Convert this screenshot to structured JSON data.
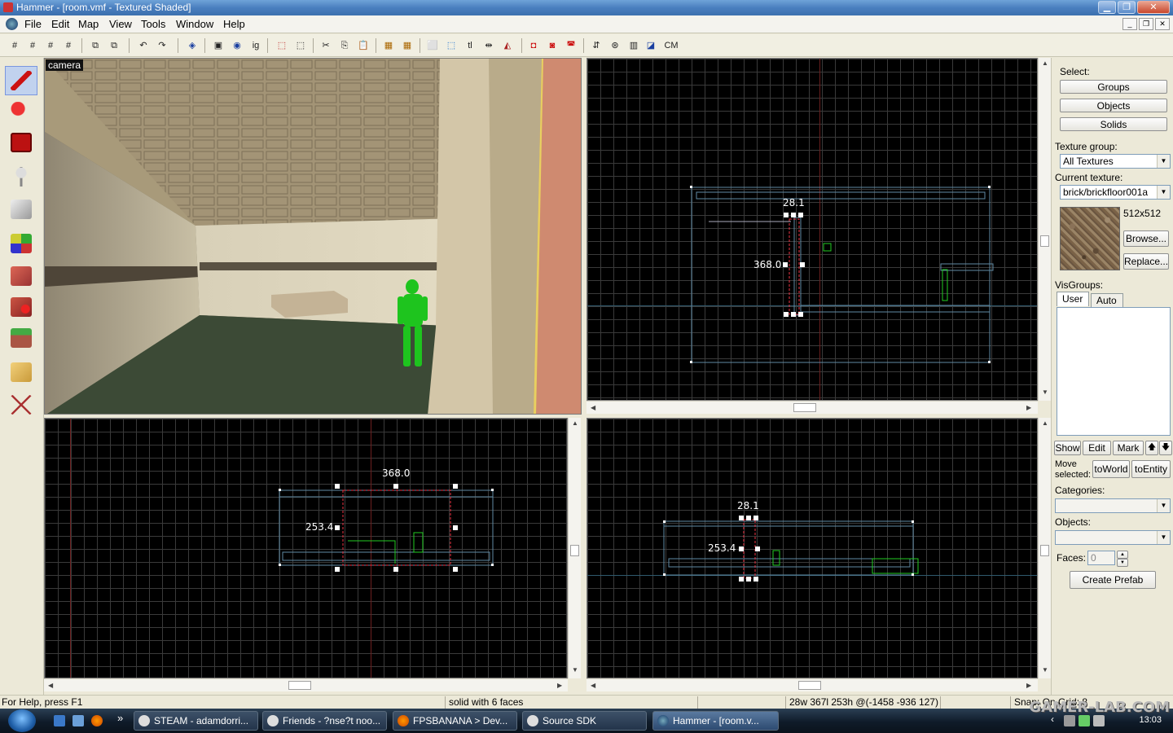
{
  "window": {
    "title": "Hammer - [room.vmf - Textured Shaded]"
  },
  "menu": {
    "items": [
      "File",
      "Edit",
      "Map",
      "View",
      "Tools",
      "Window",
      "Help"
    ]
  },
  "toolbar": {
    "tl_label": "tl",
    "cm_label": "CM"
  },
  "viewports": {
    "camera_label": "camera",
    "top": {
      "width_label": "28.1",
      "height_label": "368.0"
    },
    "front": {
      "width_label": "368.0",
      "height_label": "253.4"
    },
    "side": {
      "width_label": "28.1",
      "height_label": "253.4"
    }
  },
  "panel": {
    "select_label": "Select:",
    "groups_button": "Groups",
    "objects_button": "Objects",
    "solids_button": "Solids",
    "texture_group_label": "Texture group:",
    "texture_group_value": "All Textures",
    "current_texture_label": "Current texture:",
    "current_texture_value": "brick/brickfloor001a",
    "texture_size": "512x512",
    "browse_button": "Browse...",
    "replace_button": "Replace...",
    "visgroups_label": "VisGroups:",
    "tab_user": "User",
    "tab_auto": "Auto",
    "show_button": "Show",
    "edit_button": "Edit",
    "mark_button": "Mark",
    "up_arrow": "🡅",
    "down_arrow": "🡇",
    "move_selected_label_1": "Move",
    "move_selected_label_2": "selected:",
    "to_world_button": "toWorld",
    "to_entity_button": "toEntity",
    "categories_label": "Categories:",
    "objects_label": "Objects:",
    "faces_label": "Faces:",
    "faces_value": "0",
    "create_prefab_button": "Create Prefab"
  },
  "status": {
    "help": "For Help, press F1",
    "selection": "solid with 6 faces",
    "size": "28w 367l 253h @(-1458 -936 127)",
    "snap": "Snap: On Grid: 8"
  },
  "taskbar": {
    "tasks": [
      "STEAM - adamdorri...",
      "Friends - ?nse?t noo...",
      "FPSBANANA > Dev...",
      "Source SDK",
      "Hammer - [room.v..."
    ],
    "chevron": "»",
    "clock": "13:03"
  },
  "watermark": "GAMER-LAB.COM"
}
